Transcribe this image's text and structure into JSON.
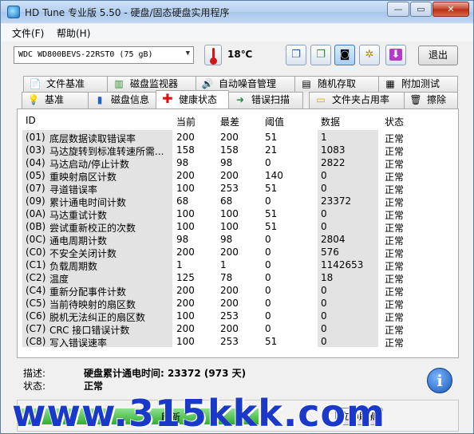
{
  "window": {
    "title": "HD Tune 专业版 5.50 - 硬盘/固态硬盘实用程序",
    "min": "—",
    "max": "▭",
    "close": "✕"
  },
  "menu": [
    "文件(F)",
    "帮助(H)"
  ],
  "toolbar": {
    "drive": "WDC WD800BEVS-22RST0 (75 gB)",
    "temperature": "18℃",
    "exit_label": "退出"
  },
  "tabs_row1": [
    "文件基准",
    "磁盘监视器",
    "自动噪音管理",
    "随机存取",
    "附加测试"
  ],
  "tabs_row2": [
    "基准",
    "磁盘信息",
    "健康状态",
    "错误扫描",
    "文件夹占用率",
    "擦除"
  ],
  "table": {
    "headers": [
      "ID",
      "当前",
      "最差",
      "阈值",
      "数据",
      "状态"
    ],
    "rows": [
      [
        "(01)",
        "底层数据读取错误率",
        "200",
        "200",
        "51",
        "1",
        "正常"
      ],
      [
        "(03)",
        "马达旋转到标准转速所需...",
        "158",
        "158",
        "21",
        "1083",
        "正常"
      ],
      [
        "(04)",
        "马达启动/停止计数",
        "98",
        "98",
        "0",
        "2822",
        "正常"
      ],
      [
        "(05)",
        "重映射扇区计数",
        "200",
        "200",
        "140",
        "0",
        "正常"
      ],
      [
        "(07)",
        "寻道错误率",
        "100",
        "253",
        "51",
        "0",
        "正常"
      ],
      [
        "(09)",
        "累计通电时间计数",
        "68",
        "68",
        "0",
        "23372",
        "正常"
      ],
      [
        "(0A)",
        "马达重试计数",
        "100",
        "100",
        "51",
        "0",
        "正常"
      ],
      [
        "(0B)",
        "尝试重新校正的次数",
        "100",
        "100",
        "51",
        "0",
        "正常"
      ],
      [
        "(0C)",
        "通电周期计数",
        "98",
        "98",
        "0",
        "2804",
        "正常"
      ],
      [
        "(C0)",
        "不安全关闭计数",
        "200",
        "200",
        "0",
        "576",
        "正常"
      ],
      [
        "(C1)",
        "负载周期数",
        "1",
        "1",
        "0",
        "1142653",
        "正常"
      ],
      [
        "(C2)",
        "温度",
        "125",
        "78",
        "0",
        "18",
        "正常"
      ],
      [
        "(C4)",
        "重新分配事件计数",
        "200",
        "200",
        "0",
        "0",
        "正常"
      ],
      [
        "(C5)",
        "当前待映射的扇区数",
        "200",
        "200",
        "0",
        "0",
        "正常"
      ],
      [
        "(C6)",
        "脱机无法纠正的扇区数",
        "100",
        "253",
        "0",
        "0",
        "正常"
      ],
      [
        "(C7)",
        "CRC 接口错误计数",
        "200",
        "200",
        "0",
        "0",
        "正常"
      ],
      [
        "(C8)",
        "写入错误速率",
        "100",
        "253",
        "51",
        "0",
        "正常"
      ]
    ]
  },
  "details": {
    "desc_label": "描述:",
    "desc_value": "硬盘累计通电时间: 23372 (973 天)",
    "status_label": "状态:",
    "status_value": "正常"
  },
  "bottom": {
    "refresh_label": "刷新",
    "now_label": "立即刷新"
  },
  "watermark": "www.315kkk.com"
}
